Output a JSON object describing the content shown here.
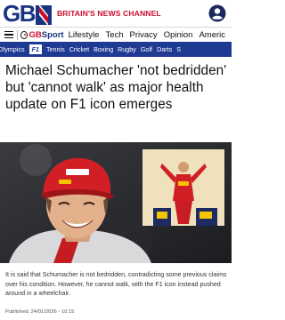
{
  "header": {
    "logo_text": "GB",
    "tagline": "BRITAIN'S NEWS CHANNEL",
    "colors": {
      "brand_blue": "#1a3380",
      "brand_red": "#c8102e",
      "nav_blue": "#1f3a93"
    }
  },
  "nav": {
    "brand_prefix": "GB",
    "brand_suffix": "Sport",
    "items": [
      "Lifestyle",
      "Tech",
      "Privacy",
      "Opinion",
      "Americ"
    ]
  },
  "subnav": {
    "items": [
      "Olympics",
      "F1",
      "Tennis",
      "Cricket",
      "Boxing",
      "Rugby",
      "Golf",
      "Darts",
      "S"
    ],
    "active": "F1"
  },
  "article": {
    "headline": "Michael Schumacher 'not bedridden' but 'cannot walk' as major health update on F1 icon emerges",
    "summary": "It is said that Schumacher is not bedridden, contradicting some previous claims over his condition. However, he cannot walk, with the F1 icon instead pushed around in a wheelchair.",
    "published": "Published: 24/01/2026 - 10:15"
  }
}
